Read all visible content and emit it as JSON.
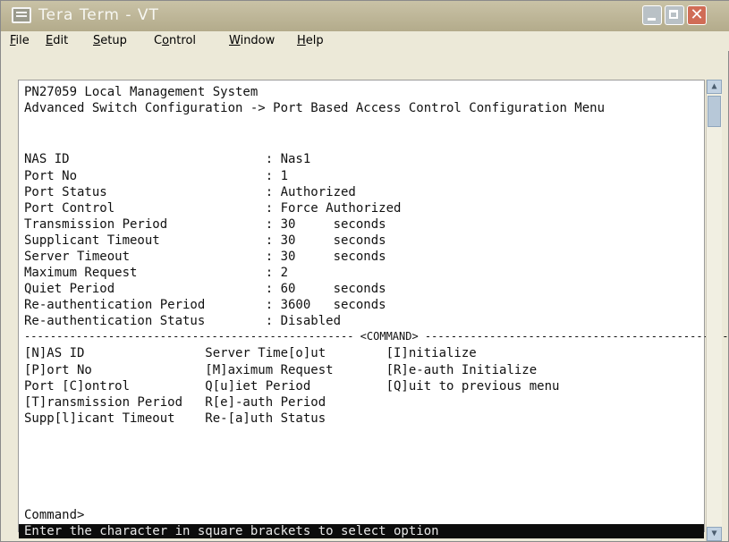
{
  "window": {
    "title": "Tera Term - VT"
  },
  "titlebar": {
    "minimize_label": "",
    "maximize_label": "",
    "close_label": "✕"
  },
  "menubar": {
    "items": [
      {
        "pre": "",
        "u": "F",
        "post": "ile"
      },
      {
        "pre": "",
        "u": "E",
        "post": "dit"
      },
      {
        "pre": "",
        "u": "S",
        "post": "etup"
      },
      {
        "pre": "C",
        "u": "o",
        "post": "ntrol"
      },
      {
        "pre": "",
        "u": "W",
        "post": "indow"
      },
      {
        "pre": "",
        "u": "H",
        "post": "elp"
      }
    ]
  },
  "terminal": {
    "header": [
      "PN27059 Local Management System",
      "Advanced Switch Configuration -> Port Based Access Control Configuration Menu"
    ],
    "fields": [
      "NAS ID                          : Nas1",
      "Port No                         : 1",
      "Port Status                     : Authorized",
      "Port Control                    : Force Authorized",
      "Transmission Period             : 30     seconds",
      "Supplicant Timeout              : 30     seconds",
      "Server Timeout                  : 30     seconds",
      "Maximum Request                 : 2",
      "Quiet Period                    : 60     seconds",
      "Re-authentication Period        : 3600   seconds",
      "Re-authentication Status        : Disabled"
    ],
    "separator": "--------------------------------------------------- <COMMAND> ---------------------------------------------------",
    "commands": [
      "[N]AS ID                Server Time[o]ut        [I]nitialize",
      "[P]ort No               [M]aximum Request       [R]e-auth Initialize",
      "Port [C]ontrol          Q[u]iet Period          [Q]uit to previous menu",
      "[T]ransmission Period   R[e]-auth Period",
      "Supp[l]icant Timeout    Re-[a]uth Status"
    ],
    "prompt": "Command>",
    "status": "Enter the character in square brackets to select option"
  },
  "scrollbar": {
    "up_arrow": "▲",
    "down_arrow": "▼"
  }
}
